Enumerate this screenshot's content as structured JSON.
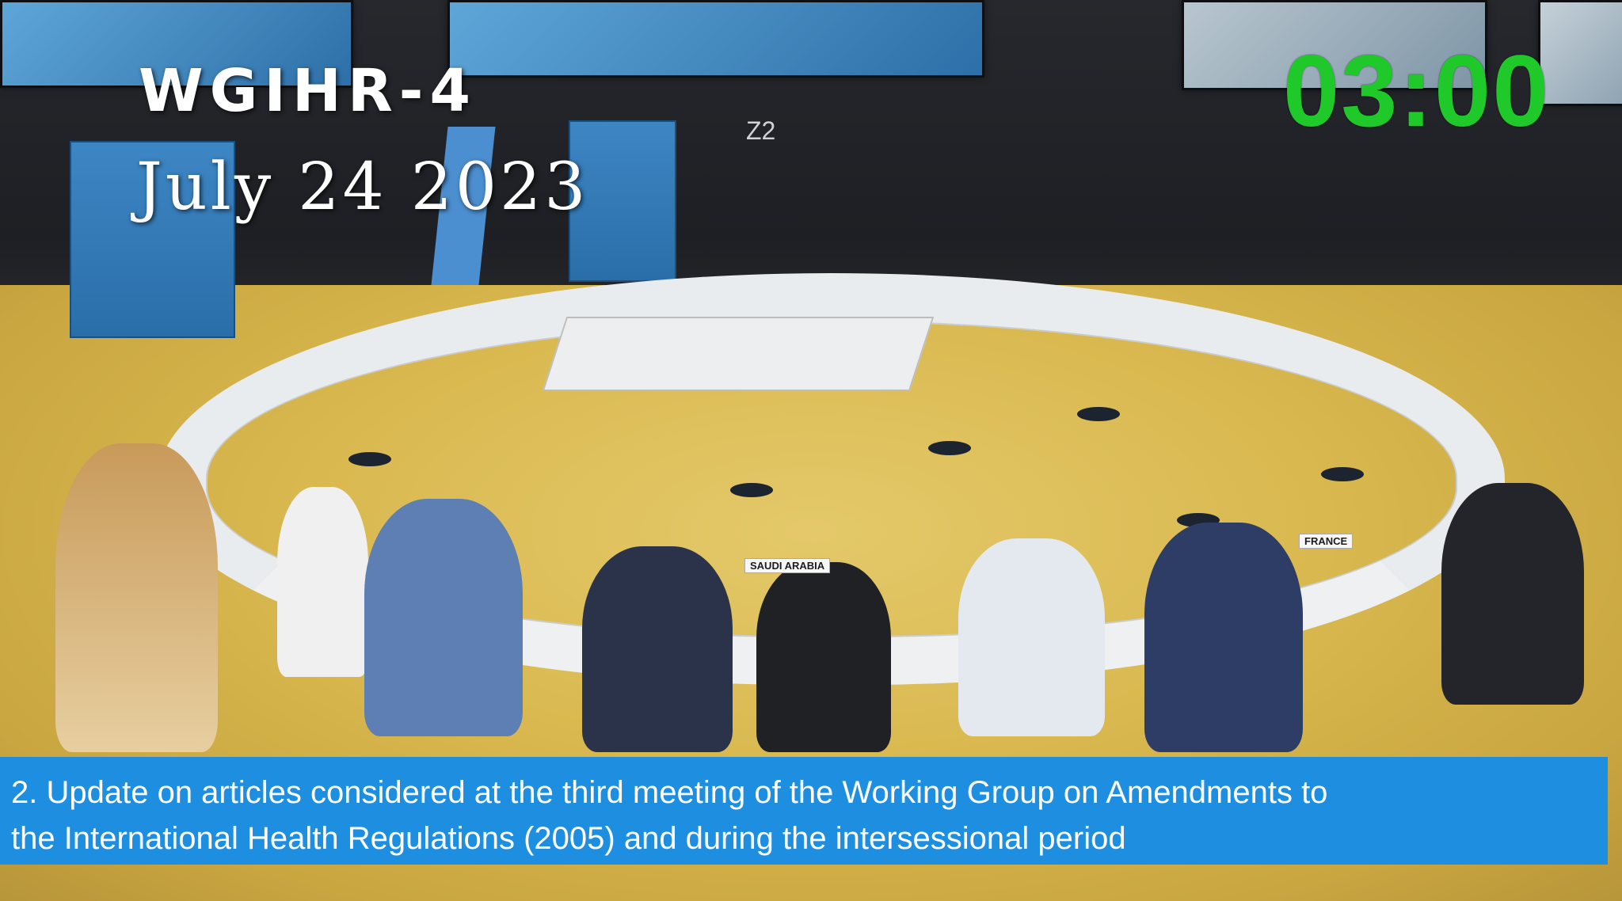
{
  "overlay": {
    "title": "WGIHR-4",
    "date": "July 24 2023",
    "timer": "03:00"
  },
  "room_sign": "Z2",
  "nameplates": {
    "saudi_arabia": "SAUDI ARABIA",
    "france": "FRANCE"
  },
  "caption": {
    "line1": "2. Update on articles considered at the third meeting of the Working Group on Amendments to",
    "line2": "the International Health Regulations (2005) and during the intersessional period"
  },
  "colors": {
    "timer": "#1fc92a",
    "caption_background": "#1e8fe0",
    "overlay_text": "#ffffff"
  }
}
